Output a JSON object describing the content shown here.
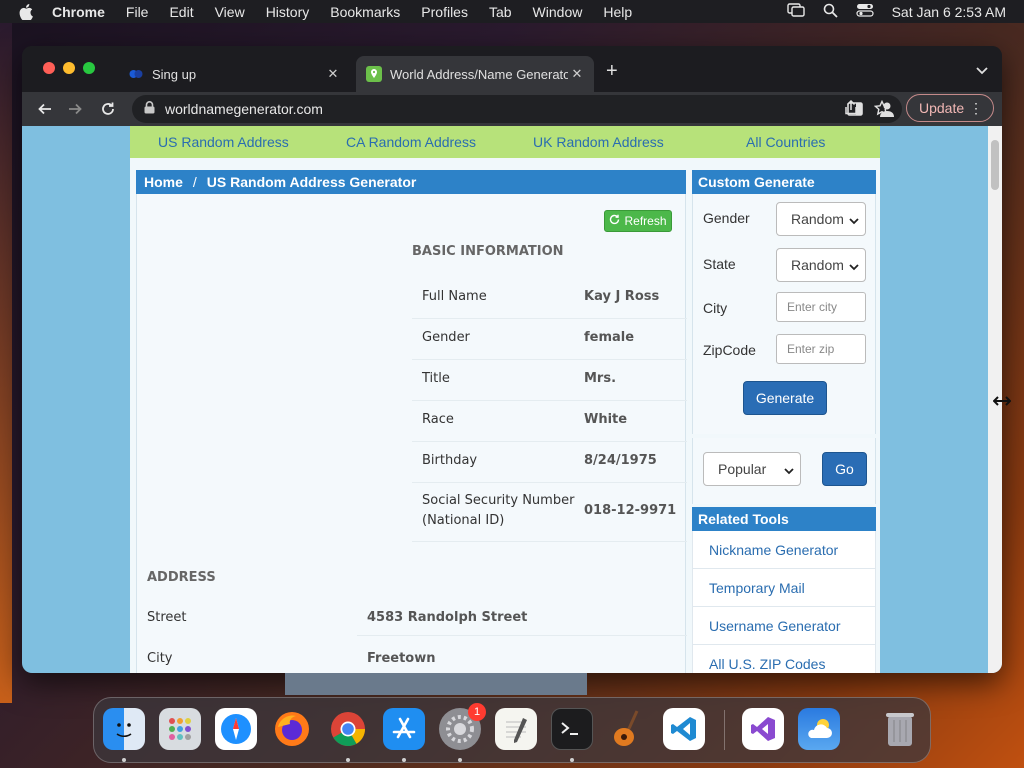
{
  "menubar": {
    "app": "Chrome",
    "items": [
      "File",
      "Edit",
      "View",
      "History",
      "Bookmarks",
      "Profiles",
      "Tab",
      "Window",
      "Help"
    ],
    "clock": "Sat Jan 6  2:53 AM"
  },
  "browser": {
    "tabs": [
      {
        "title": "Sing up"
      },
      {
        "title": "World Address/Name Generator"
      }
    ],
    "url": "worldnamegenerator.com",
    "update_label": "Update"
  },
  "site": {
    "nav": [
      "US Random Address",
      "CA Random Address",
      "UK Random Address",
      "All Countries"
    ],
    "breadcrumb": {
      "home": "Home",
      "sep": "/",
      "current": "US Random Address Generator"
    },
    "refresh_label": "Refresh",
    "basic_title": "BASIC INFORMATION",
    "basic": [
      {
        "label": "Full Name",
        "value": "Kay J Ross"
      },
      {
        "label": "Gender",
        "value": "female"
      },
      {
        "label": "Title",
        "value": "Mrs."
      },
      {
        "label": "Race",
        "value": "White"
      },
      {
        "label": "Birthday",
        "value": "8/24/1975"
      },
      {
        "label": "Social Security Number",
        "label2": "(National ID)",
        "value": "018-12-9971"
      }
    ],
    "address_title": "ADDRESS",
    "address": [
      {
        "label": "Street",
        "value": "4583 Randolph Street"
      },
      {
        "label": "City",
        "value": "Freetown"
      }
    ],
    "custom": {
      "title": "Custom Generate",
      "gender_label": "Gender",
      "gender_value": "Random",
      "state_label": "State",
      "state_value": "Random",
      "city_label": "City",
      "city_placeholder": "Enter city",
      "zip_label": "ZipCode",
      "zip_placeholder": "Enter zip",
      "generate_label": "Generate",
      "popular_value": "Popular",
      "go_label": "Go"
    },
    "related": {
      "title": "Related Tools",
      "items": [
        "Nickname Generator",
        "Temporary Mail",
        "Username Generator",
        "All U.S. ZIP Codes"
      ]
    }
  },
  "dock": {
    "apps": [
      "finder-icon",
      "launchpad-icon",
      "safari-icon",
      "firefox-icon",
      "chrome-icon",
      "app-store-icon",
      "system-settings-icon",
      "textedit-icon",
      "terminal-icon",
      "garageband-icon",
      "vscode-icon",
      "visual-studio-icon",
      "weather-icon",
      "trash-icon"
    ],
    "settings_badge": "1"
  }
}
